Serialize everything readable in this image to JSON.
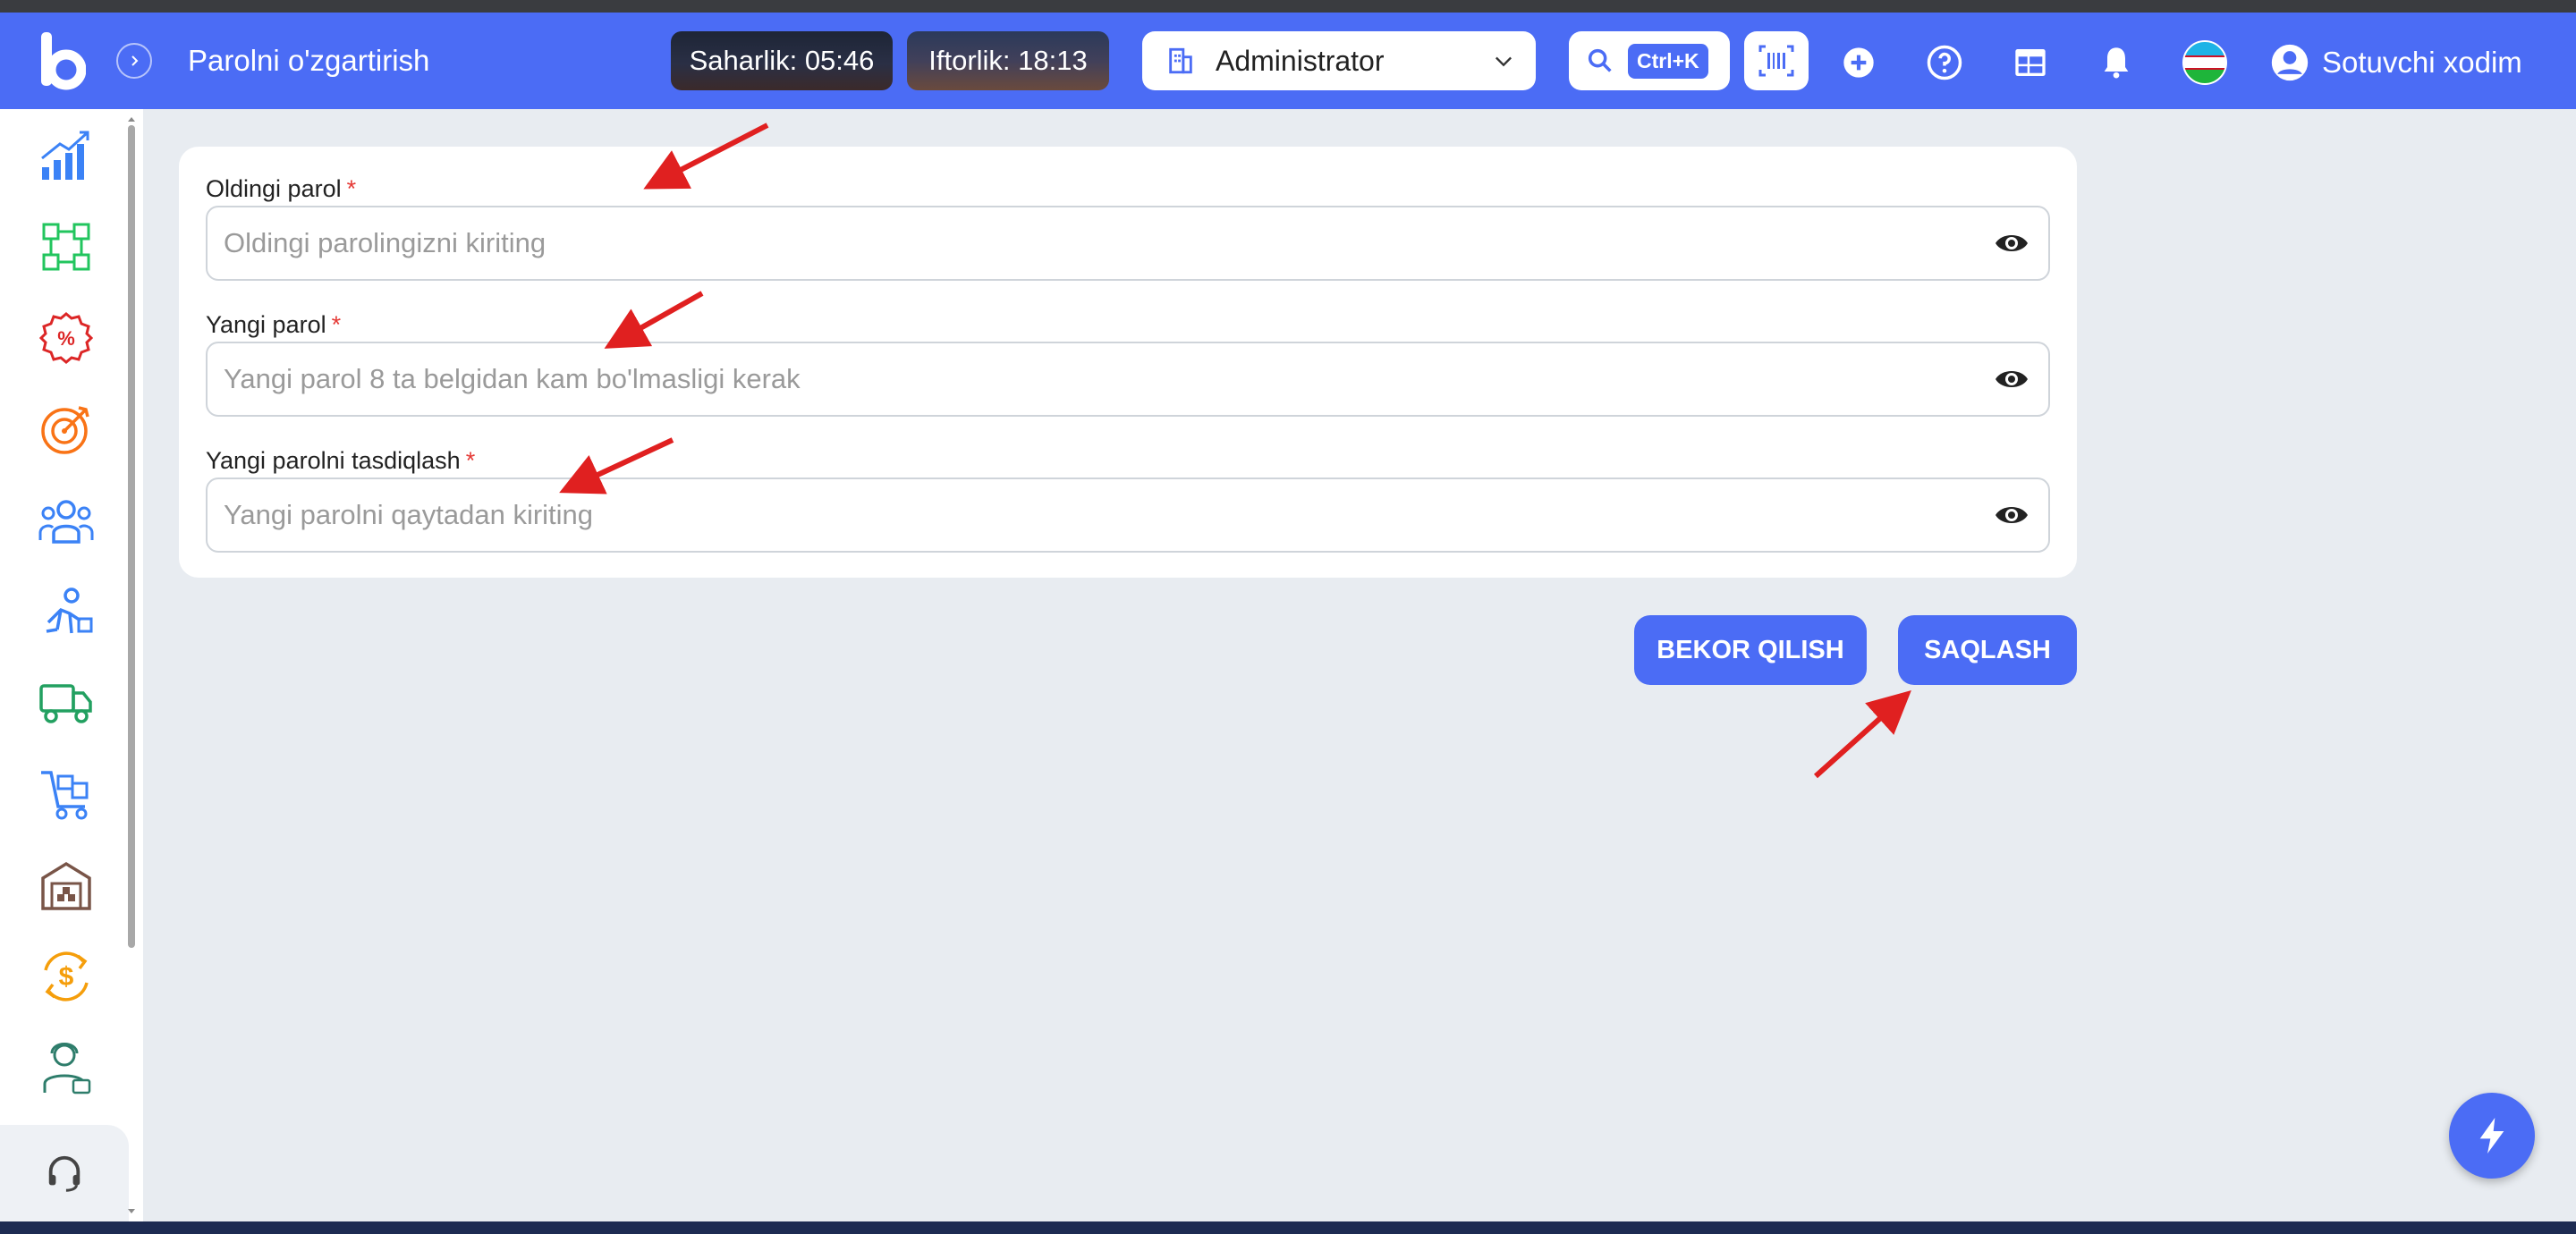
{
  "header": {
    "page_title": "Parolni o'zgartirish",
    "saharlik": "Saharlik: 05:46",
    "iftorlik": "Iftorlik: 18:13",
    "role": "Administrator",
    "search_shortcut": "Ctrl+K",
    "user_name": "Sotuvchi xodim"
  },
  "sidebar": {
    "items": [
      {
        "icon": "chart-growth-icon",
        "color": "#3b82f6"
      },
      {
        "icon": "modules-icon",
        "color": "#22c55e"
      },
      {
        "icon": "discount-badge-icon",
        "color": "#dc2626"
      },
      {
        "icon": "target-icon",
        "color": "#f97316"
      },
      {
        "icon": "users-icon",
        "color": "#3b82f6"
      },
      {
        "icon": "courier-icon",
        "color": "#3b82f6"
      },
      {
        "icon": "truck-icon",
        "color": "#22a060"
      },
      {
        "icon": "cart-icon",
        "color": "#3b82f6"
      },
      {
        "icon": "warehouse-icon",
        "color": "#795548"
      },
      {
        "icon": "currency-exchange-icon",
        "color": "#f59e0b"
      },
      {
        "icon": "employee-icon",
        "color": "#2e7d6b"
      },
      {
        "icon": "headset-icon",
        "color": "#444444"
      }
    ]
  },
  "form": {
    "old_password": {
      "label": "Oldingi parol",
      "required_mark": "*",
      "placeholder": "Oldingi parolingizni kiriting",
      "value": ""
    },
    "new_password": {
      "label": "Yangi parol",
      "required_mark": "*",
      "placeholder": "Yangi parol 8 ta belgidan kam bo'lmasligi kerak",
      "value": ""
    },
    "confirm_password": {
      "label": "Yangi parolni tasdiqlash",
      "required_mark": "*",
      "placeholder": "Yangi parolni qaytadan kiriting",
      "value": ""
    }
  },
  "actions": {
    "cancel_label": "BEKOR QILISH",
    "save_label": "SAQLASH"
  },
  "colors": {
    "brand": "#4b6cf5",
    "background": "#e8ecf1",
    "required": "#e53935",
    "annotation_arrow": "#e02020"
  }
}
